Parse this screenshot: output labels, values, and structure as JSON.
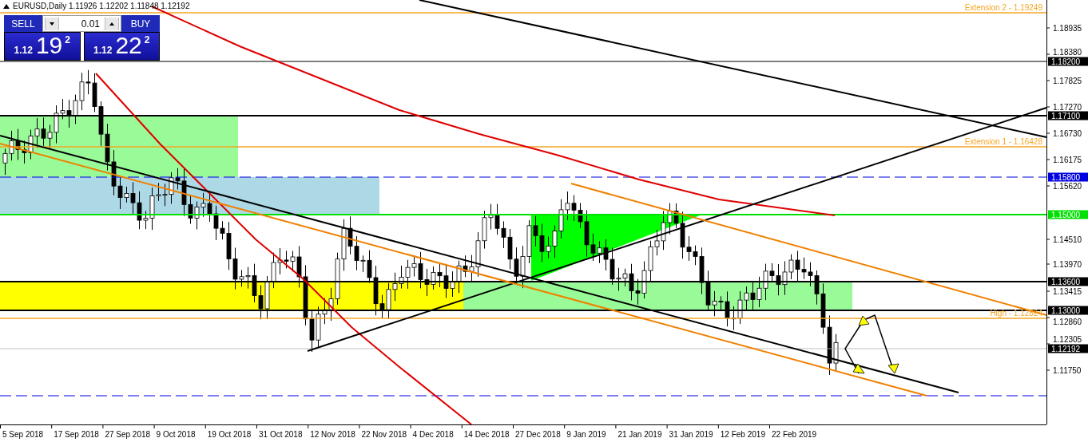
{
  "header": {
    "symbol": "EURUSD,Daily",
    "ohlc": "1.11926 1.12202 1.11848 1.12192"
  },
  "trade_panel": {
    "lot": "0.01",
    "sell": {
      "label": "SELL",
      "price_prefix": "1.12",
      "price_big": "19",
      "price_sup": "2"
    },
    "buy": {
      "label": "BUY",
      "price_prefix": "1.12",
      "price_big": "22",
      "price_sup": "2"
    }
  },
  "line_labels": [
    {
      "text": "Extension 2 - 1.19249",
      "color": "#f5a623"
    },
    {
      "text": "Extension 1 - 1.16428",
      "color": "#f5a623"
    },
    {
      "text": "High - 1.12824",
      "color": "#f5a623"
    }
  ],
  "price_axis": {
    "ticks": [
      "1.18935",
      "1.18380",
      "1.17825",
      "1.17270",
      "1.16730",
      "1.16175",
      "1.15620",
      "1.14510",
      "1.13970",
      "1.13415",
      "1.12860",
      "1.12305",
      "1.11750"
    ],
    "level_labels": [
      {
        "text": "1.18200",
        "color": "#000000"
      },
      {
        "text": "1.17100",
        "color": "#000000"
      },
      {
        "text": "1.15800",
        "color": "#0000e0"
      },
      {
        "text": "1.15000",
        "color": "#00e000"
      },
      {
        "text": "1.13600",
        "color": "#000000"
      },
      {
        "text": "1.13000",
        "color": "#000000"
      },
      {
        "text": "1.12192",
        "color": "#000000"
      }
    ]
  },
  "date_axis": {
    "labels": [
      "5 Sep 2018",
      "17 Sep 2018",
      "27 Sep 2018",
      "9 Oct 2018",
      "19 Oct 2018",
      "31 Oct 2018",
      "12 Nov 2018",
      "22 Nov 2018",
      "4 Dec 2018",
      "14 Dec 2018",
      "27 Dec 2018",
      "9 Jan 2019",
      "21 Jan 2019",
      "31 Jan 2019",
      "12 Feb 2019",
      "22 Feb 2019"
    ]
  }
}
